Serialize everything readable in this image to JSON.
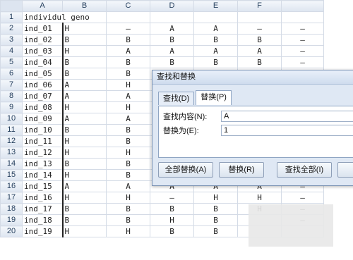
{
  "spreadsheet": {
    "columns": [
      "A",
      "B",
      "C",
      "D",
      "E",
      "F"
    ],
    "rows": [
      {
        "n": "1",
        "cells": [
          "individul geno",
          "",
          "",
          "",
          "",
          "",
          ""
        ]
      },
      {
        "n": "2",
        "cells": [
          "ind_01",
          "H",
          "–",
          "A",
          "A",
          "–",
          "–"
        ]
      },
      {
        "n": "3",
        "cells": [
          "ind_02",
          "B",
          "B",
          "B",
          "B",
          "B",
          "–"
        ]
      },
      {
        "n": "4",
        "cells": [
          "ind_03",
          "H",
          "A",
          "A",
          "A",
          "A",
          "–"
        ]
      },
      {
        "n": "5",
        "cells": [
          "ind_04",
          "B",
          "B",
          "B",
          "B",
          "B",
          "–"
        ]
      },
      {
        "n": "6",
        "cells": [
          "ind_05",
          "B",
          "B",
          "",
          "",
          "",
          ""
        ]
      },
      {
        "n": "7",
        "cells": [
          "ind_06",
          "A",
          "H",
          "",
          "",
          "",
          ""
        ]
      },
      {
        "n": "8",
        "cells": [
          "ind_07",
          "A",
          "A",
          "",
          "",
          "",
          ""
        ]
      },
      {
        "n": "9",
        "cells": [
          "ind_08",
          "H",
          "H",
          "",
          "",
          "",
          ""
        ]
      },
      {
        "n": "10",
        "cells": [
          "ind_09",
          "A",
          "A",
          "",
          "",
          "",
          ""
        ]
      },
      {
        "n": "11",
        "cells": [
          "ind_10",
          "B",
          "B",
          "",
          "",
          "",
          ""
        ]
      },
      {
        "n": "12",
        "cells": [
          "ind_11",
          "H",
          "B",
          "",
          "",
          "",
          ""
        ]
      },
      {
        "n": "13",
        "cells": [
          "ind_12",
          "H",
          "H",
          "",
          "",
          "",
          ""
        ]
      },
      {
        "n": "14",
        "cells": [
          "ind_13",
          "B",
          "B",
          "",
          "",
          "",
          ""
        ]
      },
      {
        "n": "15",
        "cells": [
          "ind_14",
          "H",
          "B",
          "",
          "",
          "",
          ""
        ]
      },
      {
        "n": "16",
        "cells": [
          "ind_15",
          "A",
          "A",
          "A",
          "A",
          "A",
          "–"
        ]
      },
      {
        "n": "17",
        "cells": [
          "ind_16",
          "H",
          "H",
          "–",
          "H",
          "H",
          "–"
        ]
      },
      {
        "n": "18",
        "cells": [
          "ind_17",
          "B",
          "B",
          "B",
          "B",
          "H",
          "–"
        ]
      },
      {
        "n": "19",
        "cells": [
          "ind_18",
          "B",
          "B",
          "H",
          "B",
          "",
          "–"
        ]
      },
      {
        "n": "20",
        "cells": [
          "ind_19",
          "H",
          "H",
          "B",
          "B",
          "",
          ""
        ]
      }
    ]
  },
  "dialog": {
    "title": "查找和替换",
    "tab_find": "查找(D)",
    "tab_replace": "替换(P)",
    "find_label": "查找内容(N):",
    "find_value": "A",
    "replace_label": "替换为(E):",
    "replace_value": "1",
    "btn_replace_all": "全部替换(A)",
    "btn_replace": "替换(R)",
    "btn_find_all": "查找全部(I)"
  }
}
